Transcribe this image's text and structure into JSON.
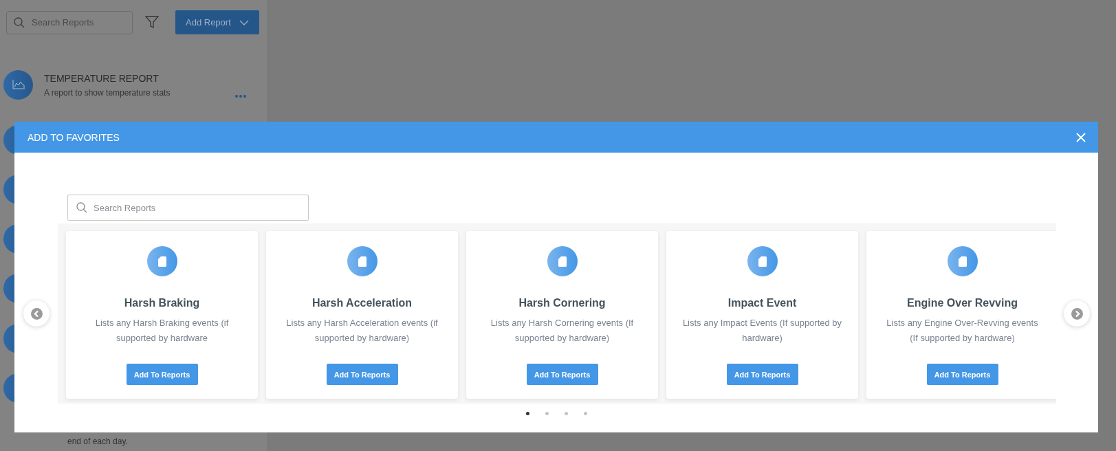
{
  "sidebar": {
    "search": {
      "placeholder": "Search Reports"
    },
    "add_button": "Add Report",
    "items": [
      {
        "title": "TEMPERATURE REPORT",
        "description": "A report to show temperature stats"
      },
      {
        "kind": "avatar"
      },
      {
        "kind": "avatar"
      },
      {
        "kind": "avatar"
      },
      {
        "kind": "avatar"
      },
      {
        "kind": "avatar"
      },
      {
        "kind": "avatar",
        "description": "end of each day."
      }
    ]
  },
  "modal": {
    "title": "ADD TO FAVORITES",
    "search": {
      "placeholder": "Search Reports"
    },
    "cards": [
      {
        "title": "Harsh Braking",
        "description": "Lists any Harsh Braking events (if supported by hardware",
        "button": "Add To Reports"
      },
      {
        "title": "Harsh Acceleration",
        "description": "Lists any Harsh Acceleration events (if supported by hardware)",
        "button": "Add To Reports"
      },
      {
        "title": "Harsh Cornering",
        "description": "Lists any Harsh Cornering events (If supported by hardware)",
        "button": "Add To Reports"
      },
      {
        "title": "Impact Event",
        "description": "Lists any Impact Events (If supported by hardware)",
        "button": "Add To Reports"
      },
      {
        "title": "Engine Over Revving",
        "description": "Lists any Engine Over-Revving events (If supported by hardware)",
        "button": "Add To Reports"
      }
    ],
    "dots": [
      {
        "selected": true
      },
      {
        "selected": false
      },
      {
        "selected": false
      },
      {
        "selected": false
      }
    ]
  }
}
